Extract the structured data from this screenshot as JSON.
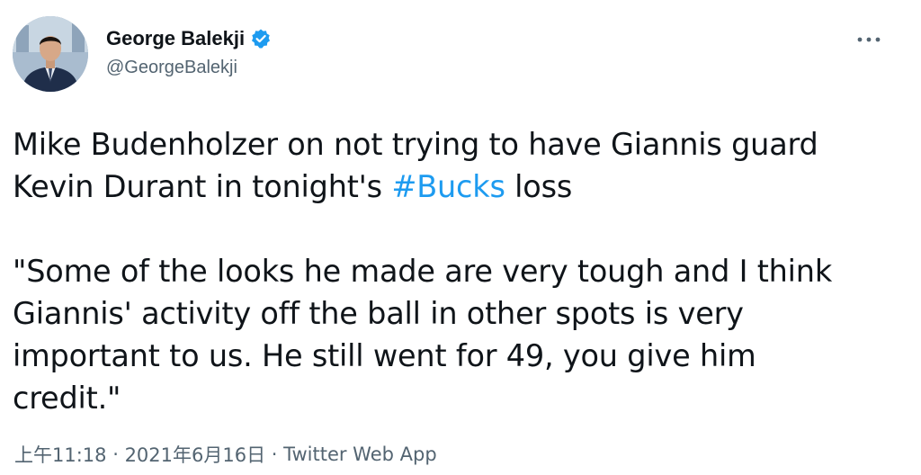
{
  "author": {
    "display_name": "George Balekji",
    "handle": "@GeorgeBalekji",
    "verified_icon": "verified-badge-icon",
    "avatar": "profile-photo"
  },
  "menu": {
    "icon": "more-options-icon"
  },
  "tweet": {
    "line1_prefix": "Mike Budenholzer on not trying to have Giannis guard",
    "line2_prefix": "Kevin Durant in tonight's ",
    "hashtag": "#Bucks",
    "line2_suffix": " loss",
    "quote_lines": [
      "\"Some of the looks he made are very tough and I think",
      "Giannis' activity off the ball in other spots is very",
      "important to us. He still went for 49, you give him",
      "credit.\""
    ]
  },
  "meta": {
    "time": "上午11:18",
    "separator": " · ",
    "date": "2021年6月16日",
    "source": "Twitter Web App"
  },
  "colors": {
    "accent": "#1d9bf0",
    "text": "#0f1419",
    "secondary": "#536471"
  }
}
